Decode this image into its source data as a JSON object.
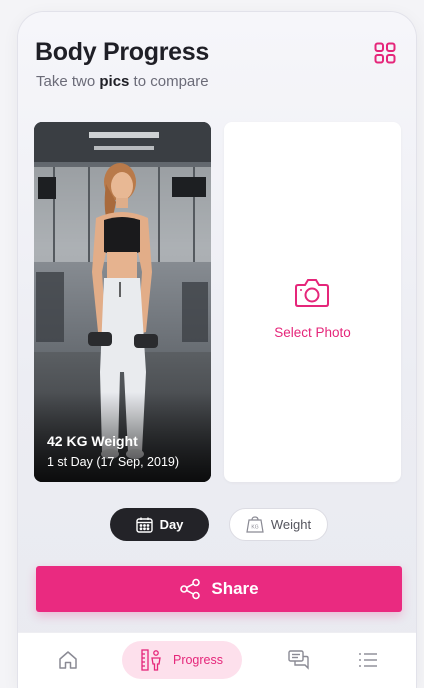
{
  "header": {
    "title": "Body Progress",
    "subtitle_pre": "Take two ",
    "subtitle_bold": "pics",
    "subtitle_post": " to compare",
    "menu_icon": "grid-icon"
  },
  "photo_card": {
    "weight": "42 KG Weight",
    "date": "1 st Day (17 Sep, 2019)"
  },
  "select_card": {
    "label": "Select Photo",
    "icon": "camera-icon"
  },
  "toggles": {
    "day_label": "Day",
    "weight_label": "Weight",
    "weight_icon_text": "KG"
  },
  "share": {
    "label": "Share"
  },
  "tabbar": {
    "progress_label": "Progress",
    "items": [
      "home-icon",
      "progress-icon",
      "chat-icon",
      "menu-list-icon"
    ]
  },
  "colors": {
    "accent": "#ea2a80",
    "dark": "#232328",
    "progress_tab_bg": "#fde0ec"
  }
}
